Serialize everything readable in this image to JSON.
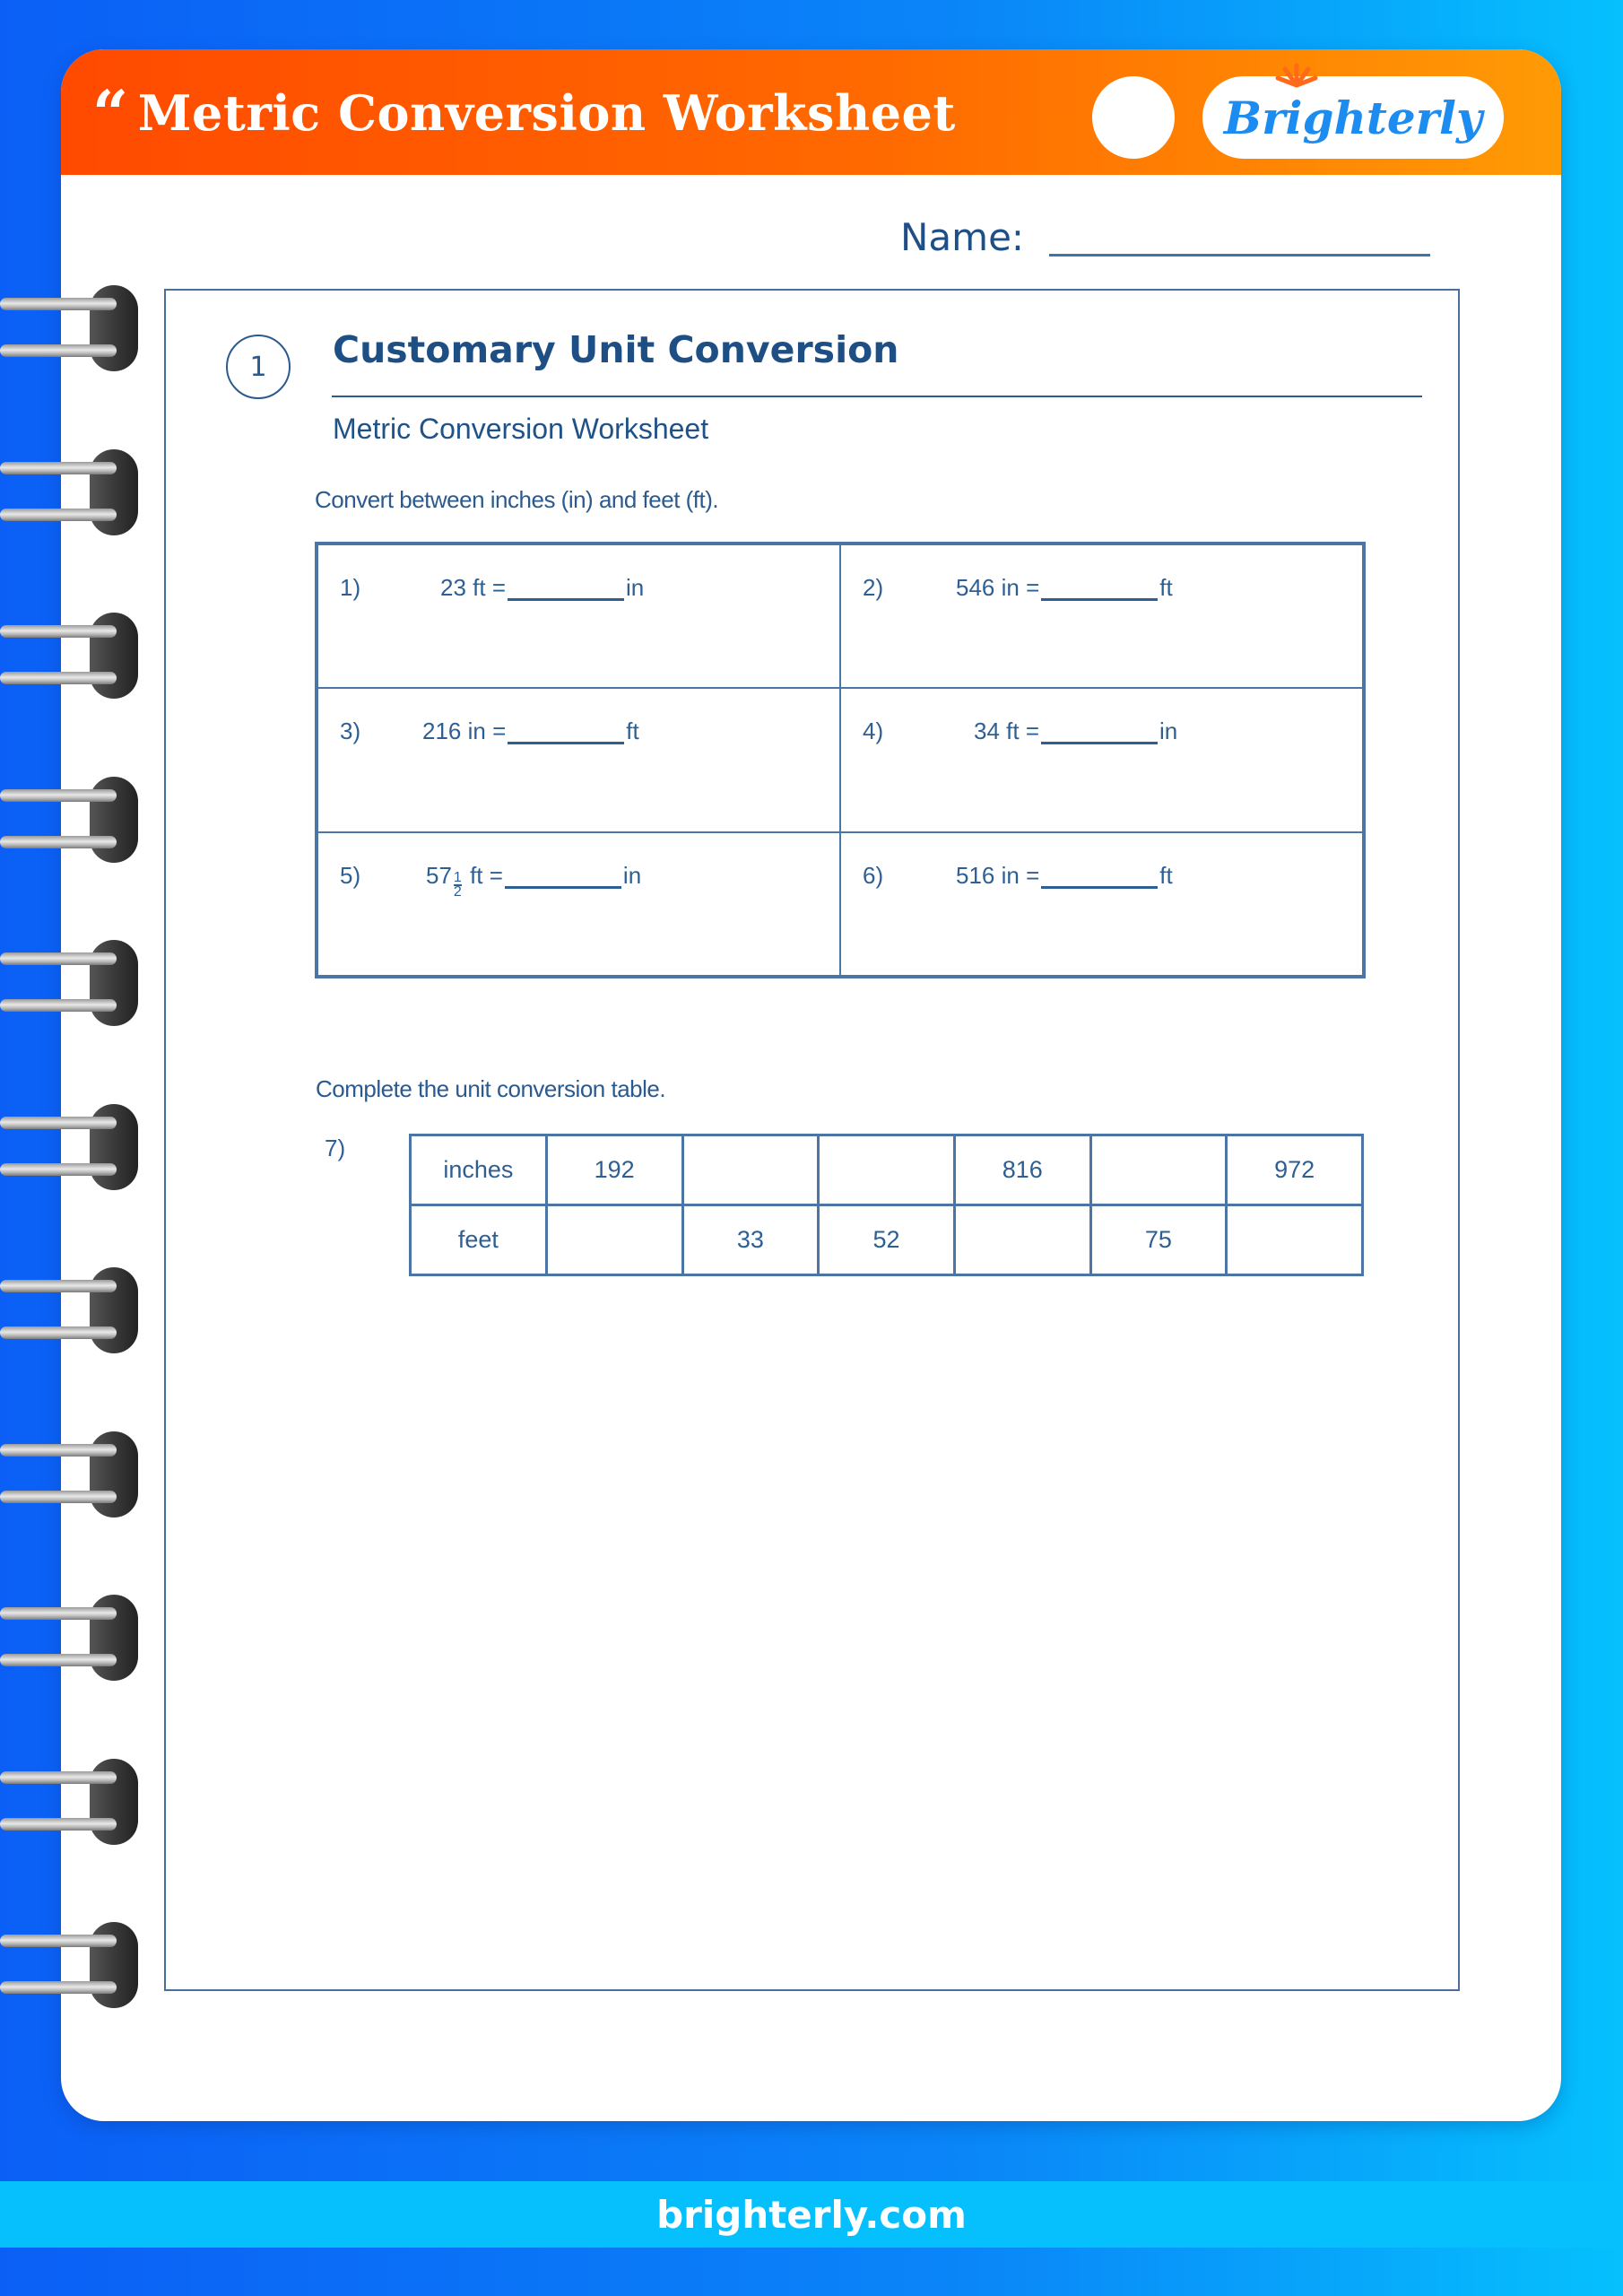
{
  "header": {
    "quote_glyph": "“",
    "title": "Metric Conversion Worksheet",
    "logo_text": "Brighterly"
  },
  "name_field": {
    "label": "Name:",
    "value": ""
  },
  "section": {
    "number": "1",
    "title": "Customary Unit Conversion",
    "subtitle": "Metric Conversion Worksheet",
    "instruction_1": "Convert between inches (in) and feet (ft).",
    "instruction_2": "Complete the unit conversion table."
  },
  "problems": [
    {
      "number": "1)",
      "prefix": "23 ft =",
      "unit": "in"
    },
    {
      "number": "2)",
      "prefix": "546 in =",
      "unit": "ft"
    },
    {
      "number": "3)",
      "prefix": "216 in =",
      "unit": "ft"
    },
    {
      "number": "4)",
      "prefix": "34 ft =",
      "unit": "in"
    },
    {
      "number": "5)",
      "whole": "57",
      "frac_num": "1",
      "frac_den": "2",
      "prefix_suffix": "ft =",
      "unit": "in"
    },
    {
      "number": "6)",
      "prefix": "516 in =",
      "unit": "ft"
    }
  ],
  "conversion_table": {
    "number": "7)",
    "rows": [
      {
        "label": "inches",
        "values": [
          "192",
          "",
          "",
          "816",
          "",
          "972"
        ]
      },
      {
        "label": "feet",
        "values": [
          "",
          "33",
          "52",
          "",
          "75",
          ""
        ]
      }
    ]
  },
  "footer": {
    "url": "brighterly.com"
  },
  "colors": {
    "header_orange": "#ff5a00",
    "text_blue": "#1e4f86",
    "brand_blue": "#1d8cf0",
    "footer_cyan": "#05c0fd"
  }
}
